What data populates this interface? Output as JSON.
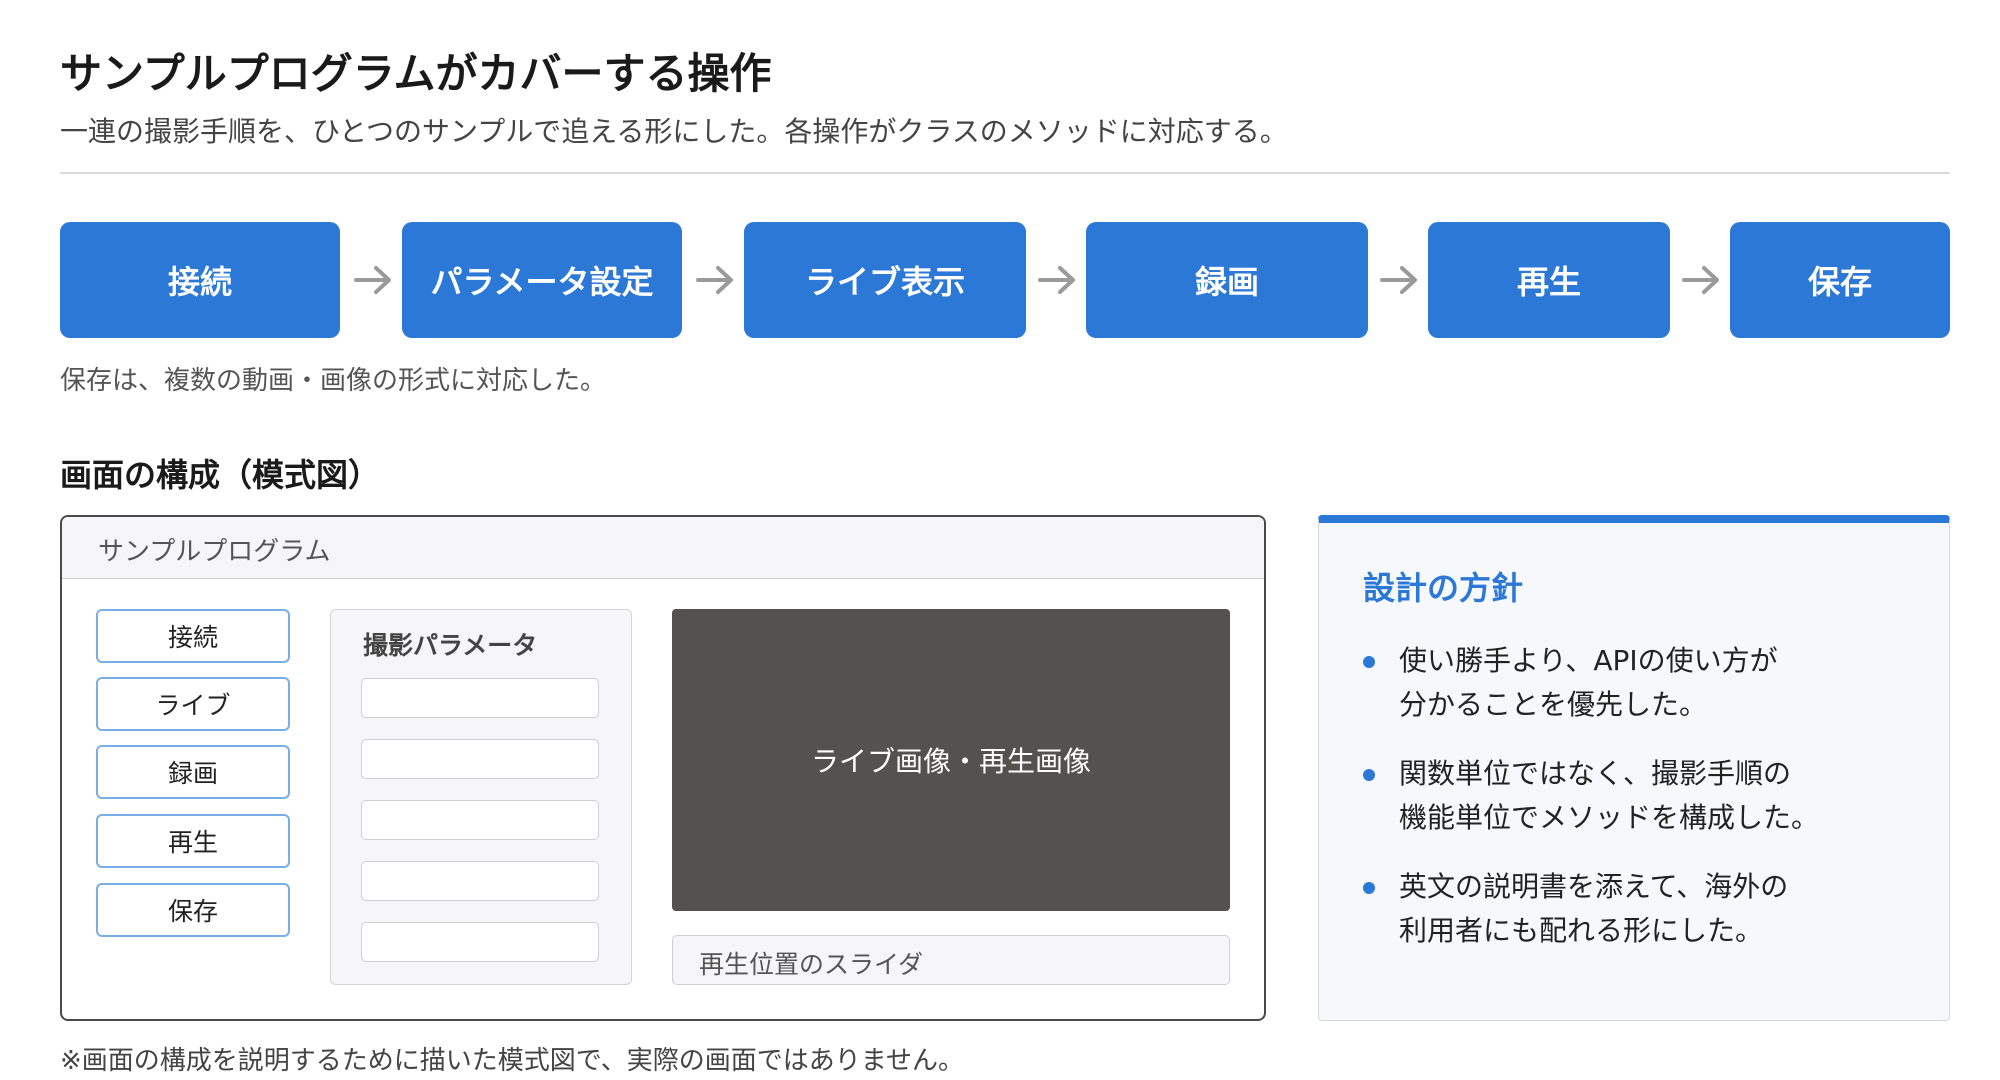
{
  "header": {
    "title": "サンプルプログラムがカバーする操作",
    "subtitle": "一連の撮影手順を、ひとつのサンプルで追える形にした。各操作がクラスのメソッドに対応する。"
  },
  "flow": {
    "steps": [
      "接続",
      "パラメータ設定",
      "ライブ表示",
      "録画",
      "再生",
      "保存"
    ],
    "arrow_icon": "arrow-right-icon",
    "note": "保存は、複数の動画・画像の形式に対応した。"
  },
  "screen_section": {
    "title": "画面の構成（模式図）",
    "window": {
      "title": "サンプルプログラム",
      "buttons": [
        "接続",
        "ライブ",
        "録画",
        "再生",
        "保存"
      ],
      "param_panel_title": "撮影パラメータ",
      "param_field_count": 5,
      "video_label": "ライブ画像・再生画像",
      "slider_label": "再生位置のスライダ"
    },
    "note": "※画面の構成を説明するために描いた模式図で、実際の画面ではありません。"
  },
  "policy": {
    "title": "設計の方針",
    "items": [
      [
        "使い勝手より、APIの使い方が",
        "分かることを優先した。"
      ],
      [
        "関数単位ではなく、撮影手順の",
        "機能単位でメソッドを構成した。"
      ],
      [
        "英文の説明書を添えて、海外の",
        "利用者にも配れる形にした。"
      ]
    ]
  },
  "colors": {
    "accent": "#2b78d6",
    "video_bg": "#53524e",
    "button_border": "#7aaee8"
  }
}
